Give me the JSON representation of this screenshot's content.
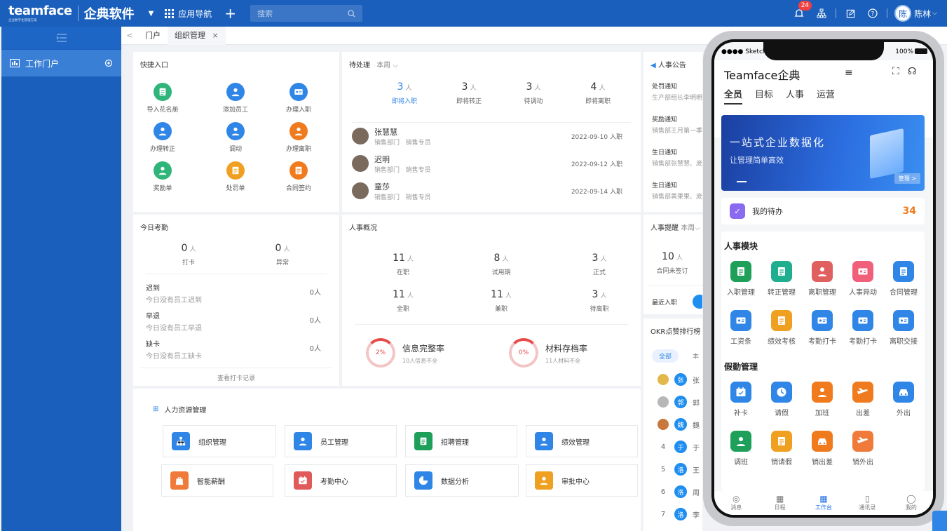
{
  "topbar": {
    "brand": "teamface",
    "brand_sub": "企业数字化管理方案",
    "product": "企典软件",
    "app_nav": "应用导航",
    "search_placeholder": "搜索",
    "notif_count": "24",
    "user_initial": "陈",
    "user_name": "陈林"
  },
  "sidebar": {
    "items": [
      {
        "label": "工作门户"
      }
    ]
  },
  "tabs": [
    {
      "label": "门户"
    },
    {
      "label": "组织管理",
      "close": "×"
    }
  ],
  "quick": {
    "title": "快捷入口",
    "items": [
      {
        "label": "导入花名册",
        "color": "#2fb57a"
      },
      {
        "label": "添加员工",
        "color": "#2f86e6"
      },
      {
        "label": "办理入职",
        "color": "#2f86e6"
      },
      {
        "label": "办理转正",
        "color": "#2f86e6"
      },
      {
        "label": "调动",
        "color": "#2f86e6"
      },
      {
        "label": "办理离职",
        "color": "#f07a1e"
      },
      {
        "label": "奖励单",
        "color": "#2fb57a"
      },
      {
        "label": "处罚单",
        "color": "#f0a020"
      },
      {
        "label": "合同签约",
        "color": "#f07a1e"
      }
    ]
  },
  "pending": {
    "title": "待处理",
    "period": "本周",
    "stats": [
      {
        "num": "3",
        "unit": "人",
        "label": "即将入职"
      },
      {
        "num": "3",
        "unit": "人",
        "label": "即将转正"
      },
      {
        "num": "3",
        "unit": "人",
        "label": "待调动"
      },
      {
        "num": "4",
        "unit": "人",
        "label": "即将离职"
      }
    ],
    "people": [
      {
        "name": "张慧慧",
        "dept": "销售部门",
        "role": "销售专员",
        "date": "2022-09-10 入职"
      },
      {
        "name": "迟明",
        "dept": "销售部门",
        "role": "销售专员",
        "date": "2022-09-12 入职"
      },
      {
        "name": "童莎",
        "dept": "销售部门",
        "role": "销售专员",
        "date": "2022-09-14 入职"
      }
    ]
  },
  "notice": {
    "title": "人事公告",
    "items": [
      {
        "title": "处罚通知",
        "desc": "生产部组长李明明"
      },
      {
        "title": "奖励通知",
        "desc": "销售部王月第一季"
      },
      {
        "title": "生日通知",
        "desc": "销售部张慧慧、庞"
      },
      {
        "title": "生日通知",
        "desc": "销售部黄果果、庞"
      }
    ]
  },
  "attendance": {
    "title": "今日考勤",
    "stats": [
      {
        "num": "0",
        "unit": "人",
        "label": "打卡"
      },
      {
        "num": "0",
        "unit": "人",
        "label": "异常"
      }
    ],
    "rows": [
      {
        "title": "迟到",
        "desc": "今日没有员工迟到",
        "value": "0人"
      },
      {
        "title": "早退",
        "desc": "今日没有员工早退",
        "value": "0人"
      },
      {
        "title": "缺卡",
        "desc": "今日没有员工缺卡",
        "value": "0人"
      }
    ],
    "link": "查看打卡记录"
  },
  "overview": {
    "title": "人事概况",
    "stats": [
      {
        "num": "11",
        "unit": "人",
        "label": "在职"
      },
      {
        "num": "8",
        "unit": "人",
        "label": "试用期"
      },
      {
        "num": "3",
        "unit": "人",
        "label": "正式"
      },
      {
        "num": "11",
        "unit": "人",
        "label": "全职"
      },
      {
        "num": "11",
        "unit": "人",
        "label": "兼职"
      },
      {
        "num": "3",
        "unit": "人",
        "label": "待离职"
      }
    ],
    "rates": [
      {
        "pct": "2%",
        "title": "信息完整率",
        "desc": "10人信息不全"
      },
      {
        "pct": "0%",
        "title": "材料存档率",
        "desc": "11人材料不全"
      }
    ]
  },
  "reminder": {
    "title": "人事提醒",
    "period": "本周",
    "stat_num": "10",
    "stat_unit": "人",
    "stat_label": "合同未签订",
    "recent": "最近入职"
  },
  "okr": {
    "title": "OKR点赞排行榜",
    "filter": "全部",
    "filter2": "本",
    "rows": [
      {
        "rank": "",
        "initial": "张",
        "name": "张"
      },
      {
        "rank": "",
        "initial": "郭",
        "name": "郭"
      },
      {
        "rank": "",
        "initial": "魏",
        "name": "魏"
      },
      {
        "rank": "4",
        "initial": "于",
        "name": "于"
      },
      {
        "rank": "5",
        "initial": "洛",
        "name": "王"
      },
      {
        "rank": "6",
        "initial": "洛",
        "name": "周"
      },
      {
        "rank": "7",
        "initial": "洛",
        "name": "李"
      }
    ]
  },
  "hr": {
    "title": "人力资源管理",
    "modules": [
      {
        "label": "组织管理",
        "color": "#2f86e6"
      },
      {
        "label": "员工管理",
        "color": "#2f86e6"
      },
      {
        "label": "招聘管理",
        "color": "#1ea05a"
      },
      {
        "label": "绩效管理",
        "color": "#2f86e6"
      },
      {
        "label": "智能薪酬",
        "color": "#f07a3a"
      },
      {
        "label": "考勤中心",
        "color": "#e05a5a"
      },
      {
        "label": "数据分析",
        "color": "#2f86e6"
      },
      {
        "label": "审批中心",
        "color": "#f0a020"
      }
    ]
  },
  "phone": {
    "carrier": "●●●● Sketch",
    "battery": "100%",
    "title": "Teamface企典",
    "tabs": [
      "全员",
      "目标",
      "人事",
      "运营"
    ],
    "banner_title": "一站式企业数据化",
    "banner_sub": "让管理简单高效",
    "banner_btn": "管理 >",
    "todo_label": "我的待办",
    "todo_count": "34",
    "section1": "人事模块",
    "hr_items": [
      {
        "label": "入职管理",
        "color": "#1ea05a"
      },
      {
        "label": "转正管理",
        "color": "#1fae8e"
      },
      {
        "label": "离职管理",
        "color": "#e06060"
      },
      {
        "label": "人事异动",
        "color": "#f0607a"
      },
      {
        "label": "合同管理",
        "color": "#2f86e6"
      },
      {
        "label": "工资条",
        "color": "#2f86e6"
      },
      {
        "label": "绩效考核",
        "color": "#f0a020"
      },
      {
        "label": "考勤打卡",
        "color": "#2f86e6"
      },
      {
        "label": "考勤打卡",
        "color": "#2f86e6"
      },
      {
        "label": "离职交接",
        "color": "#2f86e6"
      }
    ],
    "section2": "假勤管理",
    "leave_items": [
      {
        "label": "补卡",
        "color": "#2f86e6"
      },
      {
        "label": "请假",
        "color": "#2f86e6"
      },
      {
        "label": "加班",
        "color": "#f07a1e"
      },
      {
        "label": "出差",
        "color": "#f07a1e"
      },
      {
        "label": "外出",
        "color": "#2f86e6"
      },
      {
        "label": "调班",
        "color": "#1ea05a"
      },
      {
        "label": "销请假",
        "color": "#f0a020"
      },
      {
        "label": "销出差",
        "color": "#f07a1e"
      },
      {
        "label": "销外出",
        "color": "#f07a3a"
      }
    ],
    "tabbar": [
      {
        "label": "消息"
      },
      {
        "label": "日程"
      },
      {
        "label": "工作台"
      },
      {
        "label": "通讯录"
      },
      {
        "label": "我的"
      }
    ]
  }
}
